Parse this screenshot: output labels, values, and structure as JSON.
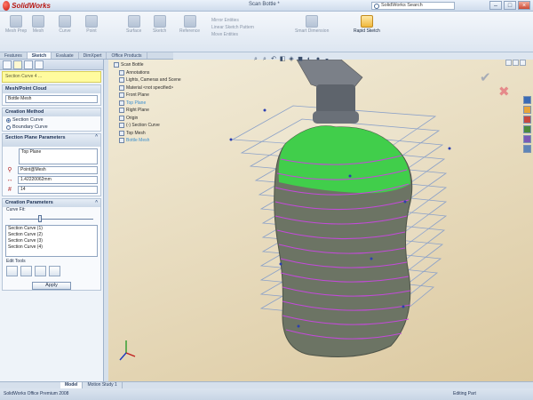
{
  "app": {
    "logo_text": "SolidWorks",
    "doc_title": "Scan Bottle *",
    "search_placeholder": "SolidWorks Search",
    "win_min": "–",
    "win_max": "□",
    "win_close": "×"
  },
  "ribbon": {
    "buttons": [
      {
        "label": "Mesh\nPrep",
        "active": false
      },
      {
        "label": "Mesh",
        "active": false
      },
      {
        "label": "Curve",
        "active": false
      },
      {
        "label": "Point",
        "active": false
      },
      {
        "label": "Surface",
        "active": false
      },
      {
        "label": "Sketch",
        "active": false
      },
      {
        "label": "Reference",
        "active": false
      },
      {
        "label": "Smart\nDimension",
        "active": false
      },
      {
        "label": "Rapid\nSketch",
        "active": true
      }
    ],
    "menu_items": [
      "Mirror Entities",
      "Linear Sketch Pattern",
      "Move Entities"
    ]
  },
  "tabs": [
    "Features",
    "Sketch",
    "Evaluate",
    "DimXpert",
    "Office Products"
  ],
  "active_tab": "Sketch",
  "pm": {
    "message": "Section Curve 4 ...",
    "mesh_group": "Mesh/Point Cloud",
    "mesh_value": "Bottle Mesh",
    "method_group": "Creation Method",
    "method_options": [
      "Section Curve",
      "Boundary Curve"
    ],
    "section_group": "Section Plane Parameters",
    "plane_value": "Top Plane",
    "ref_value": "Point@Mesh",
    "distance_value": "1.42220062mm",
    "count_value": "14",
    "creation_group": "Creation Parameters",
    "curve_fit_label": "Curve Fit:",
    "curve_fit_level": 0.35,
    "list_items": [
      "Section Curve (1)",
      "Section Curve (2)",
      "Section Curve (3)",
      "Section Curve (4)"
    ],
    "edit_tools_label": "Edit Tools",
    "apply_label": "Apply"
  },
  "tree": {
    "items": [
      {
        "label": "Scan Bottle",
        "hl": false
      },
      {
        "label": "Annotations",
        "hl": false
      },
      {
        "label": "Lights, Cameras and Scene",
        "hl": false
      },
      {
        "label": "Material <not specified>",
        "hl": false
      },
      {
        "label": "Front Plane",
        "hl": false
      },
      {
        "label": "Top Plane",
        "hl": true
      },
      {
        "label": "Right Plane",
        "hl": false
      },
      {
        "label": "Origin",
        "hl": false
      },
      {
        "label": "(-) Section Curve",
        "hl": false
      },
      {
        "label": "Top Mesh",
        "hl": false
      },
      {
        "label": "Bottle Mesh",
        "hl": true
      }
    ]
  },
  "model_tabs": [
    "Model",
    "Motion Study 1"
  ],
  "status": {
    "left": "SolidWorks Office Premium 2008",
    "right": "Editing Part"
  },
  "colors": {
    "mesh_green": "#3fd34a",
    "mesh_gray": "#6c7464",
    "curve_magenta": "#c34ad9",
    "plane_blue": "#5a7fc2"
  }
}
